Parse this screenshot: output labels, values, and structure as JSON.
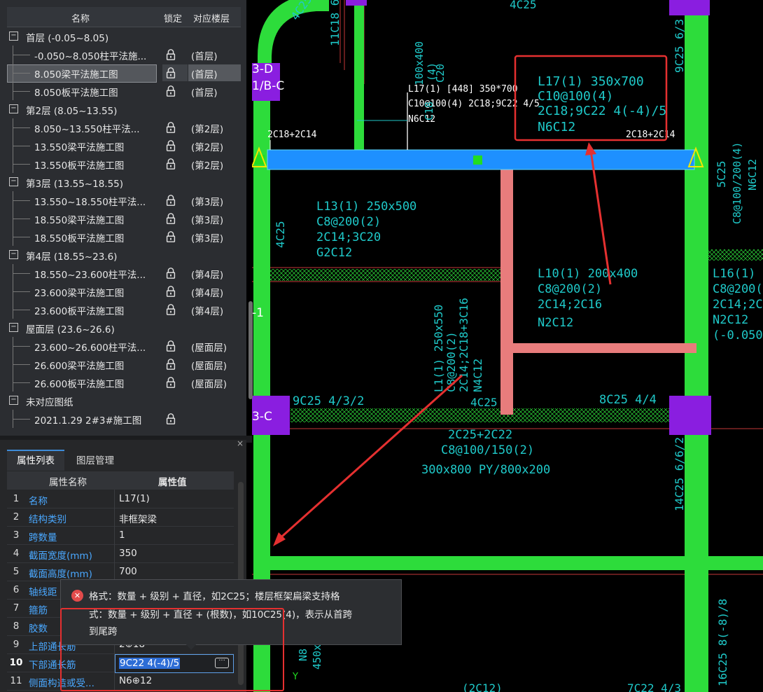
{
  "tree": {
    "headers": {
      "name": "名称",
      "lock": "锁定",
      "floor": "对应楼层"
    },
    "rows": [
      {
        "type": "group",
        "label": "首层 (-0.05~8.05)",
        "toggle": "−"
      },
      {
        "type": "child",
        "label": "-0.050~8.050柱平法施...",
        "floor": "(首层)"
      },
      {
        "type": "child",
        "label": "8.050梁平法施工图",
        "floor": "(首层)",
        "selected": true
      },
      {
        "type": "child",
        "label": "8.050板平法施工图",
        "floor": "(首层)"
      },
      {
        "type": "group",
        "label": "第2层 (8.05~13.55)",
        "toggle": "−"
      },
      {
        "type": "child",
        "label": "8.050~13.550柱平法...",
        "floor": "(第2层)"
      },
      {
        "type": "child",
        "label": "13.550梁平法施工图",
        "floor": "(第2层)"
      },
      {
        "type": "child",
        "label": "13.550板平法施工图",
        "floor": "(第2层)"
      },
      {
        "type": "group",
        "label": "第3层 (13.55~18.55)",
        "toggle": "−"
      },
      {
        "type": "child",
        "label": "13.550~18.550柱平法...",
        "floor": "(第3层)"
      },
      {
        "type": "child",
        "label": "18.550梁平法施工图",
        "floor": "(第3层)"
      },
      {
        "type": "child",
        "label": "18.550板平法施工图",
        "floor": "(第3层)"
      },
      {
        "type": "group",
        "label": "第4层 (18.55~23.6)",
        "toggle": "−"
      },
      {
        "type": "child",
        "label": "18.550~23.600柱平法...",
        "floor": "(第4层)"
      },
      {
        "type": "child",
        "label": "23.600梁平法施工图",
        "floor": "(第4层)"
      },
      {
        "type": "child",
        "label": "23.600板平法施工图",
        "floor": "(第4层)"
      },
      {
        "type": "group",
        "label": "屋面层 (23.6~26.6)",
        "toggle": "−"
      },
      {
        "type": "child",
        "label": "23.600~26.600柱平法...",
        "floor": "(屋面层)"
      },
      {
        "type": "child",
        "label": "26.600梁平法施工图",
        "floor": "(屋面层)"
      },
      {
        "type": "child",
        "label": "26.600板平法施工图",
        "floor": "(屋面层)"
      },
      {
        "type": "group",
        "label": "未对应图纸",
        "toggle": "−"
      },
      {
        "type": "child",
        "label": "2021.1.29  2#3#施工图",
        "floor": ""
      }
    ]
  },
  "props": {
    "close": "×",
    "tabs": [
      "属性列表",
      "图层管理"
    ],
    "headers": {
      "name": "属性名称",
      "value": "属性值"
    },
    "rows": [
      {
        "num": "1",
        "name": "名称",
        "value": "L17(1)"
      },
      {
        "num": "2",
        "name": "结构类别",
        "value": "非框架梁"
      },
      {
        "num": "3",
        "name": "跨数量",
        "value": "1"
      },
      {
        "num": "4",
        "name": "截面宽度(mm)",
        "value": "350"
      },
      {
        "num": "5",
        "name": "截面高度(mm)",
        "value": "700"
      },
      {
        "num": "6",
        "name": "轴线距",
        "value": ""
      },
      {
        "num": "7",
        "name": "箍筋",
        "value": ""
      },
      {
        "num": "8",
        "name": "胶数",
        "value": ""
      },
      {
        "num": "9",
        "name": "上部通长筋",
        "value": "2⊕18"
      },
      {
        "num": "10",
        "name": "下部通长筋",
        "value": ""
      },
      {
        "num": "11",
        "name": "侧面构造或受...",
        "value": "N6⊕12"
      }
    ],
    "editing_value": "9C22 4(-4)/5",
    "more_button": "···"
  },
  "tooltip": {
    "line1": "格式：数量 + 级别 + 直径，如2C25；楼层框架扁梁支持格",
    "line2": "式：数量 + 级别 + 直径 + (根数)，如10C25(4)，表示从首跨",
    "line3": "到尾跨"
  },
  "cad": {
    "axis_labels": [
      "3-D",
      "1/B-C",
      "3-C",
      "-1"
    ],
    "beam_main_top": [
      "L17(1) [448] 350*700",
      "C10@100(4) 2C18;9C22 4/5",
      "N6C12"
    ],
    "beam_main_red": [
      "L17(1) 350x700",
      "C10@100(4)",
      "2C18;9C22 4(-4)/5",
      "N6C12"
    ],
    "support_left": "2C18+2C14",
    "support_right": "2C18+2C14",
    "beam_L13": [
      "L13(1) 250x500",
      "C8@200(2)",
      "2C14;3C20",
      "G2C12"
    ],
    "beam_L10": [
      "L10(1) 200x400",
      "C8@200(2)",
      "2C14;2C16",
      "N2C12"
    ],
    "beam_L16": [
      "L16(1) 2",
      "C8@200(",
      "2C14;2C1",
      "N2C12",
      "(-0.050)"
    ],
    "beam_L1": [
      "L1(1) 250x550",
      "C8@200(2)",
      "2C14;2C18+3C16",
      "N4C12"
    ],
    "frame_beam": [
      "2C25+2C22",
      "C8@100/150(2)",
      "300x800 PY/800x200"
    ],
    "misc": [
      "9C25 4/3/2",
      "4C25",
      "8C25 4/4",
      "4C25",
      "11C18 6/",
      "4C25",
      "9C25 6/3",
      "5C25",
      "C8@100/200(4)",
      "N6C12",
      "14C25 6/6/2",
      "16C25 8(-8)/8",
      "(2C12)",
      "7C22 4/3",
      "4C25",
      "N8",
      "450x"
    ],
    "col_top": [
      "100x400",
      "(4)",
      "C20",
      "C18"
    ],
    "axis_y": "Y"
  },
  "colors": {
    "beam_green": "#2ddc3b",
    "selected_beam": "#1e90ff",
    "beam_pink": "#e87c7c",
    "column_purple": "#8a1ee0",
    "cad_text": "#1fc9c9",
    "annotation_red": "#e53030",
    "edge_red": "#c43838"
  }
}
